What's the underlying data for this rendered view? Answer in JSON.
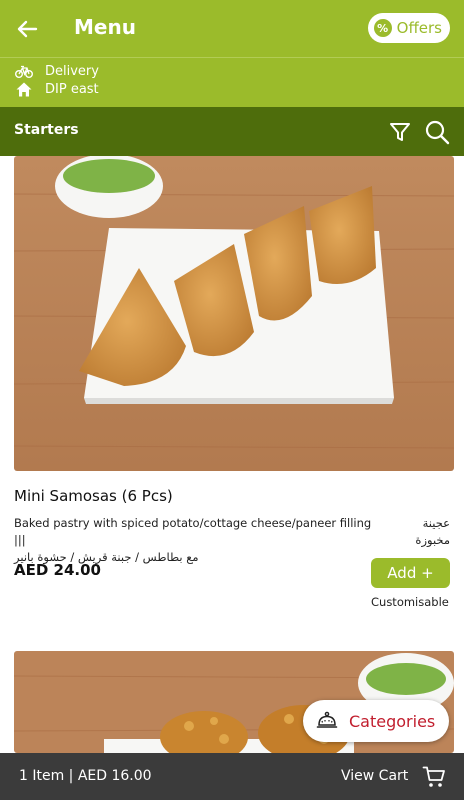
{
  "header": {
    "title": "Menu",
    "offers_label": "Offers"
  },
  "info": {
    "mode": "Delivery",
    "location": "DIP east"
  },
  "category_bar": {
    "title": "Starters"
  },
  "item": {
    "name": "Mini Samosas (6 Pcs)",
    "description_en": "Baked pastry with spiced potato/cottage cheese/paneer filling |||",
    "description_ar_1": "عجينة مخبوزة",
    "description_ar_2": "مع بطاطس / جبنة قريش / حشوة بانير",
    "price": "AED 24.00",
    "add_label": "Add +",
    "customisable": "Customisable"
  },
  "categories_button": {
    "label": "Categories"
  },
  "cart": {
    "summary": "1 Item | AED 16.00",
    "view_cart": "View Cart"
  },
  "icons": {
    "back": "arrow-left-icon",
    "offers": "percent-badge-icon",
    "delivery": "bicycle-icon",
    "location": "home-icon",
    "filter": "funnel-icon",
    "search": "search-icon",
    "categories": "cloche-icon",
    "cart": "cart-icon"
  },
  "colors": {
    "header": "#9bbb2b",
    "category_bar": "#4e6d0c",
    "cart_bar": "#3b3b3b",
    "categories_text": "#c11e2e"
  }
}
